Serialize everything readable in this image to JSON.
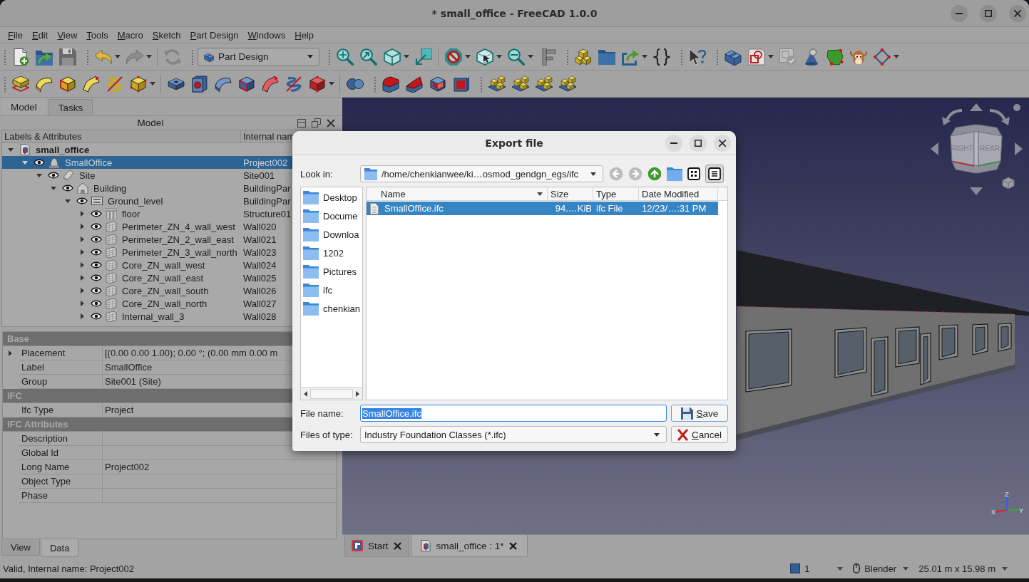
{
  "window": {
    "title": "* small_office - FreeCAD 1.0.0"
  },
  "menu": [
    "File",
    "Edit",
    "View",
    "Tools",
    "Macro",
    "Sketch",
    "Part Design",
    "Windows",
    "Help"
  ],
  "toolbar": {
    "undo": {
      "disabled": false
    },
    "redo": {
      "disabled": true
    },
    "refresh": {
      "disabled": true
    },
    "workbench": "Part Design"
  },
  "combo_view": {
    "tabs": [
      {
        "label": "Model",
        "selected": true
      },
      {
        "label": "Tasks",
        "selected": false
      }
    ],
    "title": "Model",
    "tree": {
      "columns": [
        "Labels & Attributes",
        "Internal nam"
      ],
      "items": [
        {
          "label": "small_office",
          "kind": "document",
          "expanded": true,
          "selected": false,
          "children": [
            {
              "label": "SmallOffice",
              "internal_name": "Project002",
              "kind": "project",
              "visible": true,
              "expanded": true,
              "selected": true,
              "children": [
                {
                  "label": "Site",
                  "internal_name": "Site001",
                  "kind": "site",
                  "visible": true,
                  "expanded": true,
                  "selected": false,
                  "children": [
                    {
                      "label": "Building",
                      "internal_name": "BuildingPar",
                      "kind": "building",
                      "visible": true,
                      "expanded": true,
                      "selected": false,
                      "children": [
                        {
                          "label": "Ground_level",
                          "internal_name": "BuildingPar",
                          "kind": "level",
                          "visible": true,
                          "expanded": true,
                          "selected": false,
                          "children": [
                            {
                              "label": "floor",
                              "internal_name": "Structure01",
                              "kind": "structure",
                              "visible": true,
                              "expanded": false,
                              "selected": false
                            },
                            {
                              "label": "Perimeter_ZN_4_wall_west",
                              "internal_name": "Wall020",
                              "kind": "wall",
                              "visible": true,
                              "expanded": false,
                              "selected": false
                            },
                            {
                              "label": "Perimeter_ZN_2_wall_east",
                              "internal_name": "Wall021",
                              "kind": "wall",
                              "visible": true,
                              "expanded": false,
                              "selected": false
                            },
                            {
                              "label": "Perimeter_ZN_3_wall_north",
                              "internal_name": "Wall023",
                              "kind": "wall",
                              "visible": true,
                              "expanded": false,
                              "selected": false
                            },
                            {
                              "label": "Core_ZN_wall_west",
                              "internal_name": "Wall024",
                              "kind": "wall",
                              "visible": true,
                              "expanded": false,
                              "selected": false
                            },
                            {
                              "label": "Core_ZN_wall_east",
                              "internal_name": "Wall025",
                              "kind": "wall",
                              "visible": true,
                              "expanded": false,
                              "selected": false
                            },
                            {
                              "label": "Core_ZN_wall_south",
                              "internal_name": "Wall026",
                              "kind": "wall",
                              "visible": true,
                              "expanded": false,
                              "selected": false
                            },
                            {
                              "label": "Core_ZN_wall_north",
                              "internal_name": "Wall027",
                              "kind": "wall",
                              "visible": true,
                              "expanded": false,
                              "selected": false
                            },
                            {
                              "label": "Internal_wall_3",
                              "internal_name": "Wall028",
                              "kind": "wall",
                              "visible": true,
                              "expanded": false,
                              "selected": false
                            }
                          ]
                        }
                      ]
                    }
                  ]
                }
              ]
            }
          ]
        }
      ]
    }
  },
  "properties": {
    "groups": [
      {
        "name": "Base",
        "properties": [
          {
            "name": "Placement",
            "value": "[(0.00 0.00 1.00); 0.00 °; (0.00 mm 0.00 m",
            "expanded": false
          },
          {
            "name": "Label",
            "value": "SmallOffice"
          },
          {
            "name": "Group",
            "value": "Site001 (Site)"
          }
        ]
      },
      {
        "name": "IFC",
        "properties": [
          {
            "name": "Ifc Type",
            "value": "Project"
          }
        ]
      },
      {
        "name": "IFC Attributes",
        "properties": [
          {
            "name": "Description"
          },
          {
            "name": "Global Id"
          },
          {
            "name": "Long Name",
            "value": "Project002"
          },
          {
            "name": "Object Type"
          },
          {
            "name": "Phase"
          }
        ]
      }
    ],
    "tabs": [
      {
        "label": "View",
        "selected": false
      },
      {
        "label": "Data",
        "selected": true
      }
    ]
  },
  "viewport": {
    "navigation_cube": {
      "faces": [
        "RIGHT",
        "REAR"
      ]
    },
    "axes": [
      {
        "label": "X",
        "color": "#d42a2a"
      },
      {
        "label": "Y",
        "color": "#2aa83a"
      },
      {
        "label": "Z",
        "color": "#3a5ae0"
      }
    ]
  },
  "document_tabs": [
    {
      "label": "Start",
      "kind": "start",
      "selected": false
    },
    {
      "label": "small_office : 1*",
      "kind": "document",
      "selected": true
    }
  ],
  "status_bar": {
    "message": "Valid, Internal name: Project002",
    "items": [
      {
        "text": "1",
        "kind": "square"
      },
      {
        "text": "Blender",
        "kind": "mouse"
      },
      {
        "text": "25.01 m x 15.98 m",
        "kind": "plain"
      }
    ]
  },
  "dialog": {
    "title": "Export file",
    "look_in_label": "Look in:",
    "path": "/home/chenkianwee/ki…osmod_gendgn_egs/ifc",
    "nav_buttons": [
      {
        "disabled": true
      },
      {
        "disabled": true
      },
      {
        "disabled": false
      }
    ],
    "view_buttons": [
      {
        "selected": false
      },
      {
        "selected": true
      }
    ],
    "places": [
      "Desktop",
      "Docume",
      "Downloa",
      "1202",
      "Pictures",
      "ifc",
      "chenkian"
    ],
    "columns": [
      "Name",
      "Size",
      "Type",
      "Date Modified"
    ],
    "files": [
      {
        "name": "SmallOffice.ifc",
        "size": "94.…KiB",
        "type": "ifc File",
        "date_modified": "12/23/…:31 PM",
        "selected": true
      }
    ],
    "file_name_label": "File name:",
    "file_name": {
      "value": "SmallOffice.ifc",
      "selected": true
    },
    "file_type_label": "Files of type:",
    "file_type": "Industry Foundation Classes (*.ifc)",
    "buttons": [
      {
        "label": "Save",
        "kind": "save"
      },
      {
        "label": "Cancel",
        "kind": "cancel"
      }
    ]
  }
}
